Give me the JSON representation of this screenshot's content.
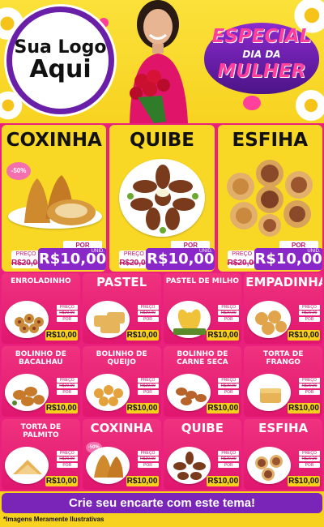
{
  "logo": {
    "line1": "Sua Logo",
    "line2": "Aqui"
  },
  "badge": {
    "line1": "ESPECIAL",
    "line2": "DIA DA",
    "line3": "MULHER"
  },
  "featured": [
    {
      "name": "COXINHA",
      "discount": "-50%",
      "por": "POR",
      "preco_label": "PREÇO",
      "old_price": "R$20,00",
      "unit": "UNID.",
      "price": "R$10,00"
    },
    {
      "name": "QUIBE",
      "por": "POR",
      "preco_label": "PREÇO",
      "old_price": "R$20,00",
      "unit": "UNID.",
      "price": "R$10,00"
    },
    {
      "name": "ESFIHA",
      "por": "POR",
      "preco_label": "PREÇO",
      "old_price": "R$20,00",
      "unit": "UNID.",
      "price": "R$10,00"
    }
  ],
  "items": [
    {
      "name": "ENROLADINHO",
      "preco_label": "PREÇO",
      "old_price": "R$20,00",
      "por": "POR",
      "price": "R$10,00"
    },
    {
      "name": "PASTEL",
      "preco_label": "PREÇO",
      "old_price": "R$20,00",
      "por": "POR",
      "price": "R$10,00"
    },
    {
      "name": "PASTEL DE MILHO",
      "preco_label": "PREÇO",
      "old_price": "R$20,00",
      "por": "POR",
      "price": "R$10,00"
    },
    {
      "name": "EMPADINHA",
      "preco_label": "PREÇO",
      "old_price": "R$20,00",
      "por": "POR",
      "price": "R$10,00"
    },
    {
      "name": "BOLINHO DE BACALHAU",
      "preco_label": "PREÇO",
      "old_price": "R$20,00",
      "por": "POR",
      "price": "R$10,00"
    },
    {
      "name": "BOLINHO DE QUEIJO",
      "preco_label": "PREÇO",
      "old_price": "R$20,00",
      "por": "POR",
      "price": "R$10,00"
    },
    {
      "name": "BOLINHO DE CARNE SECA",
      "preco_label": "PREÇO",
      "old_price": "R$20,00",
      "por": "POR",
      "price": "R$10,00"
    },
    {
      "name": "TORTA DE FRANGO",
      "preco_label": "PREÇO",
      "old_price": "R$20,00",
      "por": "POR",
      "price": "R$10,00"
    },
    {
      "name": "TORTA DE PALMITO",
      "preco_label": "PREÇO",
      "old_price": "R$20,00",
      "por": "POR",
      "price": "R$10,00"
    },
    {
      "name": "COXINHA",
      "discount": "-50%",
      "preco_label": "PREÇO",
      "old_price": "R$20,00",
      "por": "POR",
      "price": "R$10,00"
    },
    {
      "name": "QUIBE",
      "preco_label": "PREÇO",
      "old_price": "R$20,00",
      "por": "POR",
      "price": "R$10,00"
    },
    {
      "name": "ESFIHA",
      "preco_label": "PREÇO",
      "old_price": "R$20,00",
      "por": "POR",
      "price": "R$10,00"
    }
  ],
  "cta": "Crie seu encarte com este tema!",
  "disclaimer": "*Imagens Meramente Ilustrativas",
  "colors": {
    "pink": "#e9207e",
    "purple": "#7a25b8",
    "yellow": "#f9d825"
  }
}
